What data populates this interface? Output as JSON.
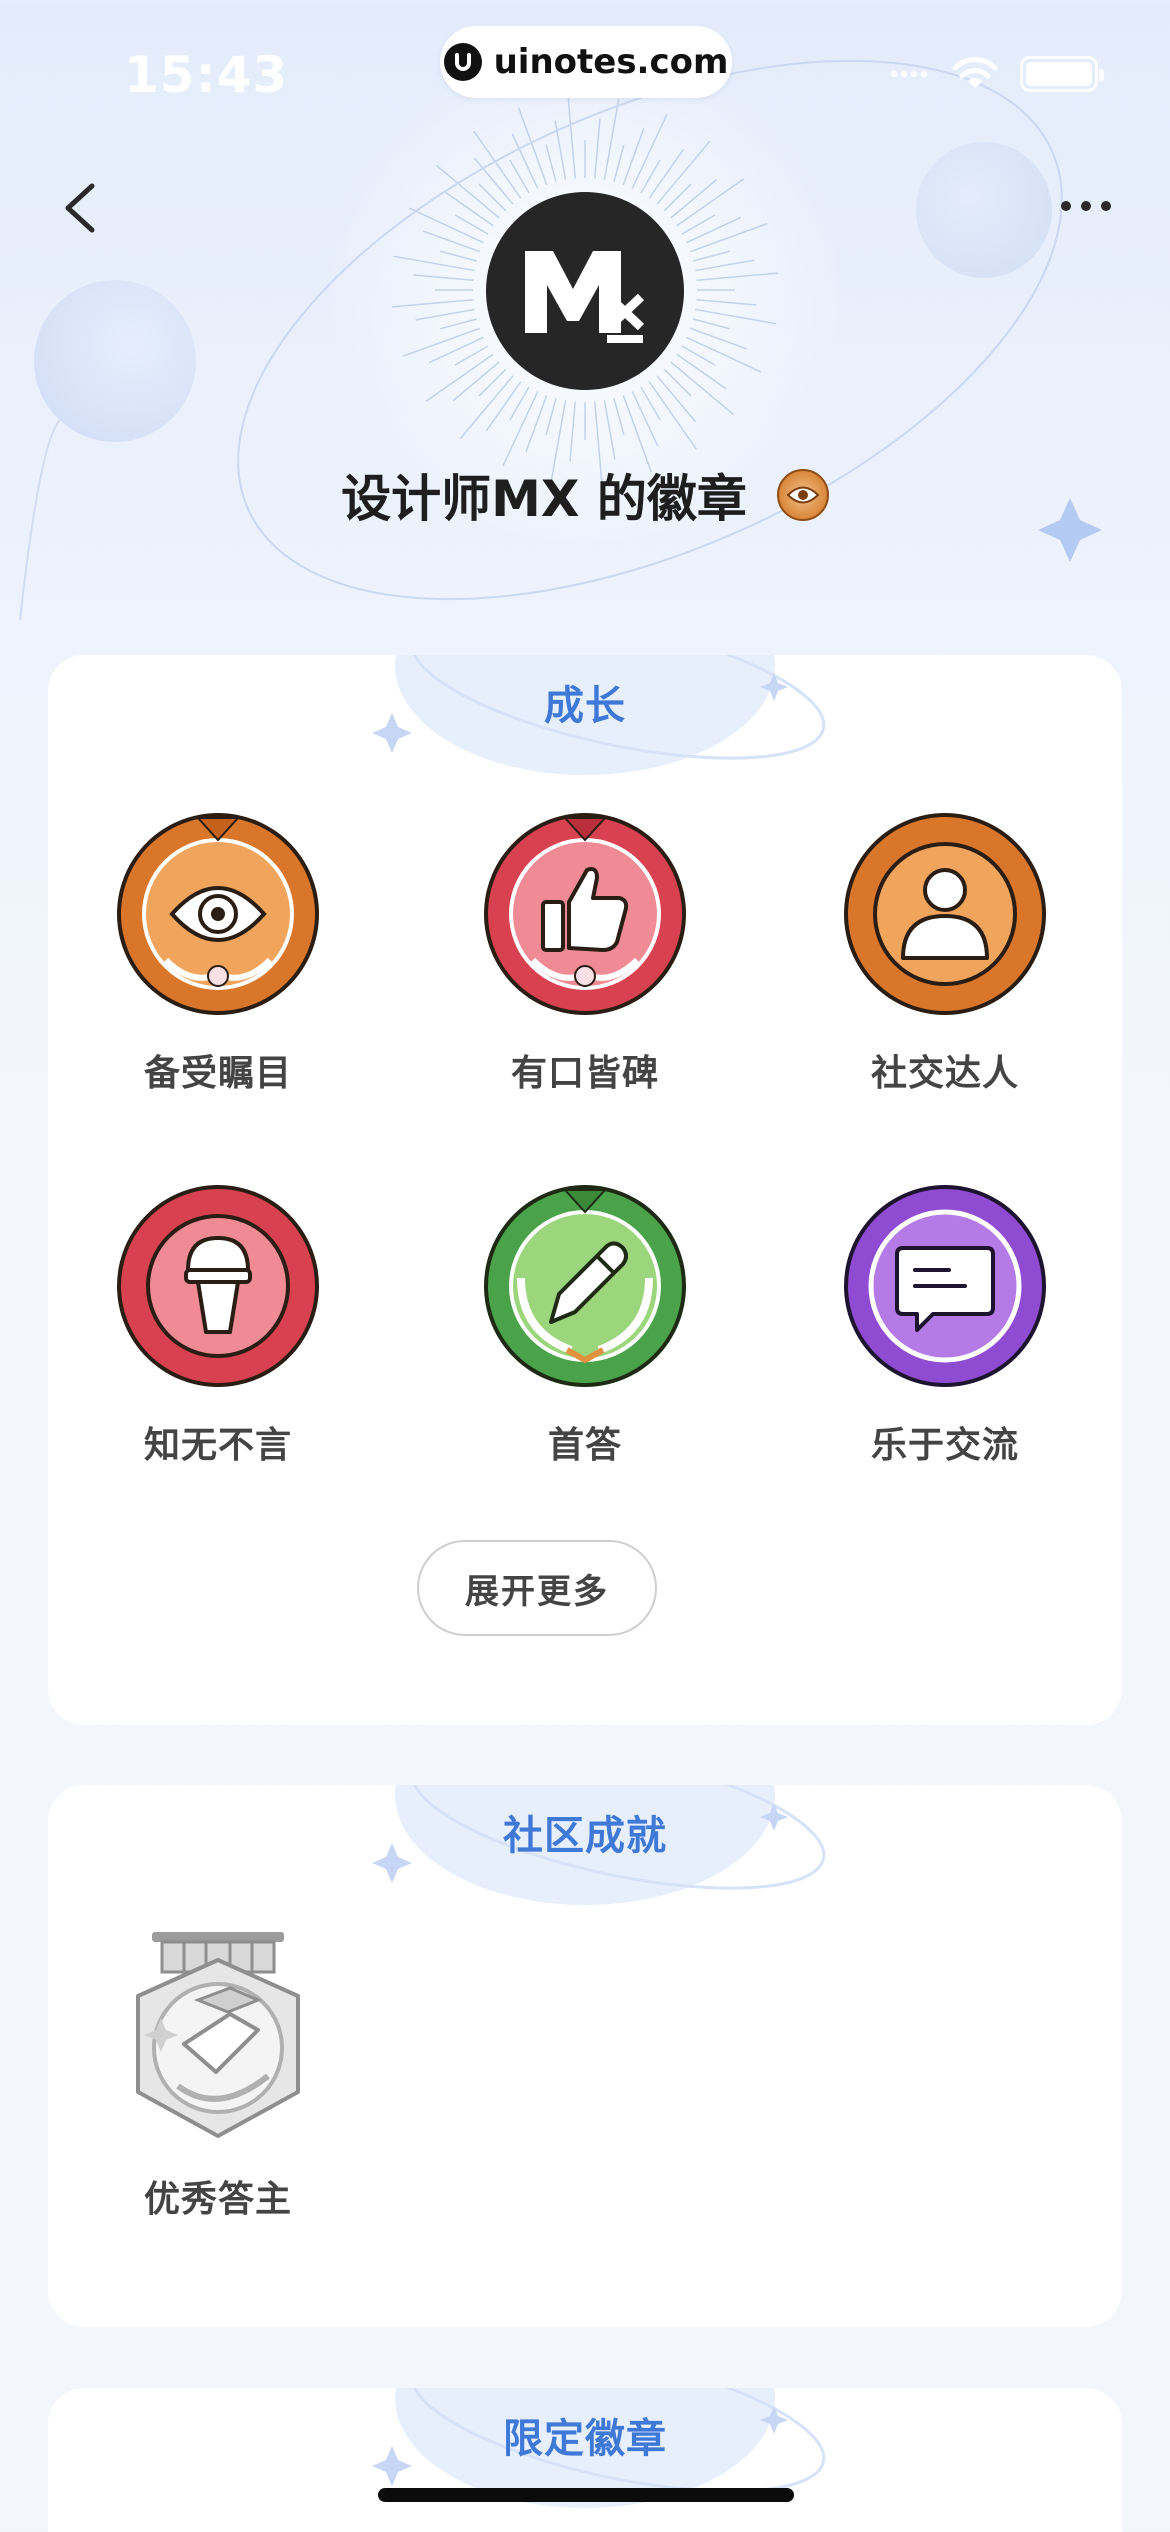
{
  "status_bar": {
    "time": "15:43",
    "url": "uinotes.com"
  },
  "nav": {
    "back_icon": "chevron-left-icon",
    "more_icon": "more-horizontal-icon"
  },
  "profile": {
    "avatar_text": "Mx",
    "title": "设计师MX 的徽章",
    "title_badge_icon": "eye-icon"
  },
  "sections": [
    {
      "title": "成长",
      "badges": [
        {
          "label": "备受瞩目",
          "icon": "eye-icon",
          "color": "#d9762a"
        },
        {
          "label": "有口皆碑",
          "icon": "thumbs-up-icon",
          "color": "#d8414f"
        },
        {
          "label": "社交达人",
          "icon": "person-icon",
          "color": "#d9762a"
        },
        {
          "label": "知无不言",
          "icon": "microphone-icon",
          "color": "#d8414f"
        },
        {
          "label": "首答",
          "icon": "pencil-icon",
          "color": "#4aa34a"
        },
        {
          "label": "乐于交流",
          "icon": "chat-bubble-icon",
          "color": "#8f4bd1"
        }
      ],
      "expand_label": "展开更多"
    },
    {
      "title": "社区成就",
      "badges": [
        {
          "label": "优秀答主",
          "icon": "medal-icon",
          "color": "#b9b9b9"
        }
      ]
    },
    {
      "title": "限定徽章",
      "badges": []
    }
  ],
  "colors": {
    "accent": "#3f79d8",
    "bronze": "#d9762a",
    "red": "#d8414f",
    "green": "#4aa34a",
    "purple": "#8f4bd1"
  }
}
